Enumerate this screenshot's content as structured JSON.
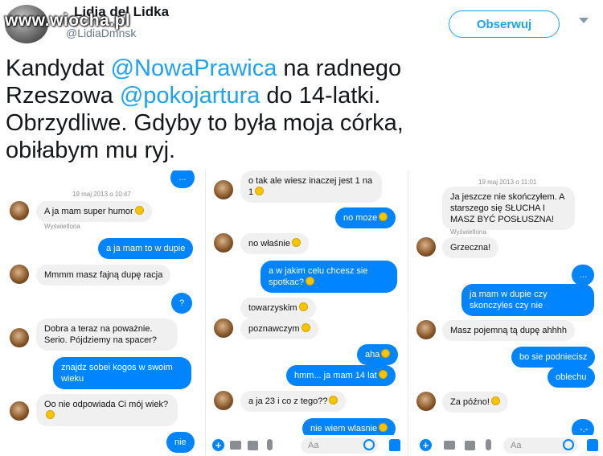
{
  "tweet": {
    "display_name": "Lidia del Lidka",
    "handle": "@LidiaDmnsk",
    "watermark": "www.wiocha.pl",
    "follow_label": "Obserwuj",
    "text_lines": [
      {
        "pre": "Kandydat ",
        "mention": "@NowaPrawica",
        "post": " na radnego"
      },
      {
        "pre": "Rzeszowa ",
        "mention": "@pokojartura",
        "post": " do 14-latki."
      },
      {
        "pre": "Obrzydliwe. Gdyby to była moja córka,",
        "mention": "",
        "post": ""
      },
      {
        "pre": "obiłabym mu ryj.",
        "mention": "",
        "post": ""
      }
    ]
  },
  "chat1": {
    "m0": "...",
    "timestamp": "19 maj 2013 o 10:47",
    "m1": "A ja mam super humor",
    "seen": "Wyświetlona",
    "m2": "a ja mam to w dupie",
    "m3": "Mmmm masz fajną dupę racja",
    "m4": "?",
    "m5": "Dobra a teraz na poważnie. Serio. Pójdziemy na spacer?",
    "m6": "znajdz sobei kogos w swoim wieku",
    "m7": "Oo nie odpowiada Ci mój wiek?",
    "m8": "nie"
  },
  "chat2": {
    "m1": "o tak  ale wiesz inaczej jest 1 na 1",
    "m2": "no moze",
    "m3": "no właśnie",
    "m4": "a w jakim celu chcesz sie spotkac?",
    "m5": "towarzyskim",
    "m6": "poznawczym",
    "m7": "aha",
    "m8": "hmm... ja mam 14 lat",
    "m9": "a ja 23  i co z tego??",
    "m10": "nie wiem wlasnie",
    "input_placeholder": "Aa"
  },
  "chat3": {
    "timestamp": "19 maj 2013 o 11:01",
    "m1": "Ja jeszcze nie skończyłem. A starszego się SŁUCHA I MASZ BYĆ POSŁUSZNA!",
    "seen": "Wyświetlona",
    "m2": "Grzeczna!",
    "m3": "...",
    "m4": "ja mam w dupie czy skonczyles czy nie",
    "m5": "Masz pojemną tą dupę ahhhh",
    "m6": "bo sie podniecisz",
    "m7": "oblechu",
    "m8": "Za późno!",
    "m9": "-.-",
    "input_placeholder": "Aa"
  },
  "colors": {
    "twitter_blue": "#1da1f2",
    "messenger_blue": "#0084ff",
    "incoming_bubble": "#f0f0f0"
  },
  "icons": [
    "plus-icon",
    "camera-icon",
    "image-icon",
    "mic-icon",
    "smile-icon",
    "thumbs-up-icon",
    "emoji-icon",
    "chevron-down-icon"
  ]
}
